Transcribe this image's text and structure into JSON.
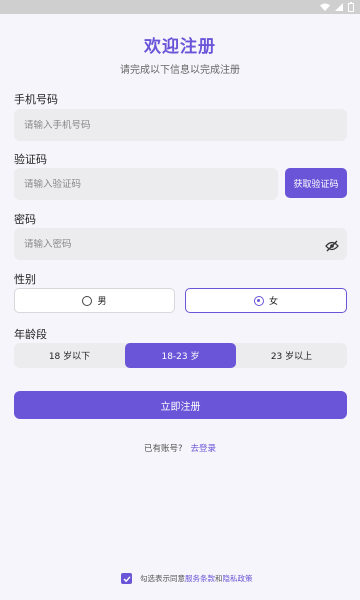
{
  "page": {
    "title": "欢迎注册",
    "subtitle": "请完成以下信息以完成注册"
  },
  "form": {
    "phone_label": "手机号码",
    "phone_placeholder": "请输入手机号码",
    "phone_value": "",
    "code_label": "验证码",
    "code_placeholder": "请输入验证码",
    "code_value": "",
    "get_code_button": "获取验证码",
    "password_label": "密码",
    "password_placeholder": "请输入密码",
    "password_value": "",
    "gender_label": "性别",
    "gender_options": [
      {
        "label": "男",
        "selected": false
      },
      {
        "label": "女",
        "selected": true
      }
    ],
    "age_label": "年龄段",
    "age_options": [
      {
        "label": "18 岁以下",
        "selected": false
      },
      {
        "label": "18-23 岁",
        "selected": true
      },
      {
        "label": "23 岁以上",
        "selected": false
      }
    ],
    "submit_button": "立即注册"
  },
  "login": {
    "prompt": "已有账号?",
    "link": "去登录"
  },
  "agreement": {
    "checked": true,
    "prefix": "勾选表示同意",
    "terms": "服务条款",
    "and": "和",
    "privacy": "隐私政策"
  },
  "colors": {
    "accent": "#6a55d8",
    "field_bg": "#ececef",
    "page_bg": "#f6f5fb"
  },
  "icons": {
    "status": [
      "wifi-icon",
      "signal-icon",
      "battery-icon"
    ],
    "password_toggle": "eye-off-icon",
    "check": "checkmark-icon"
  }
}
